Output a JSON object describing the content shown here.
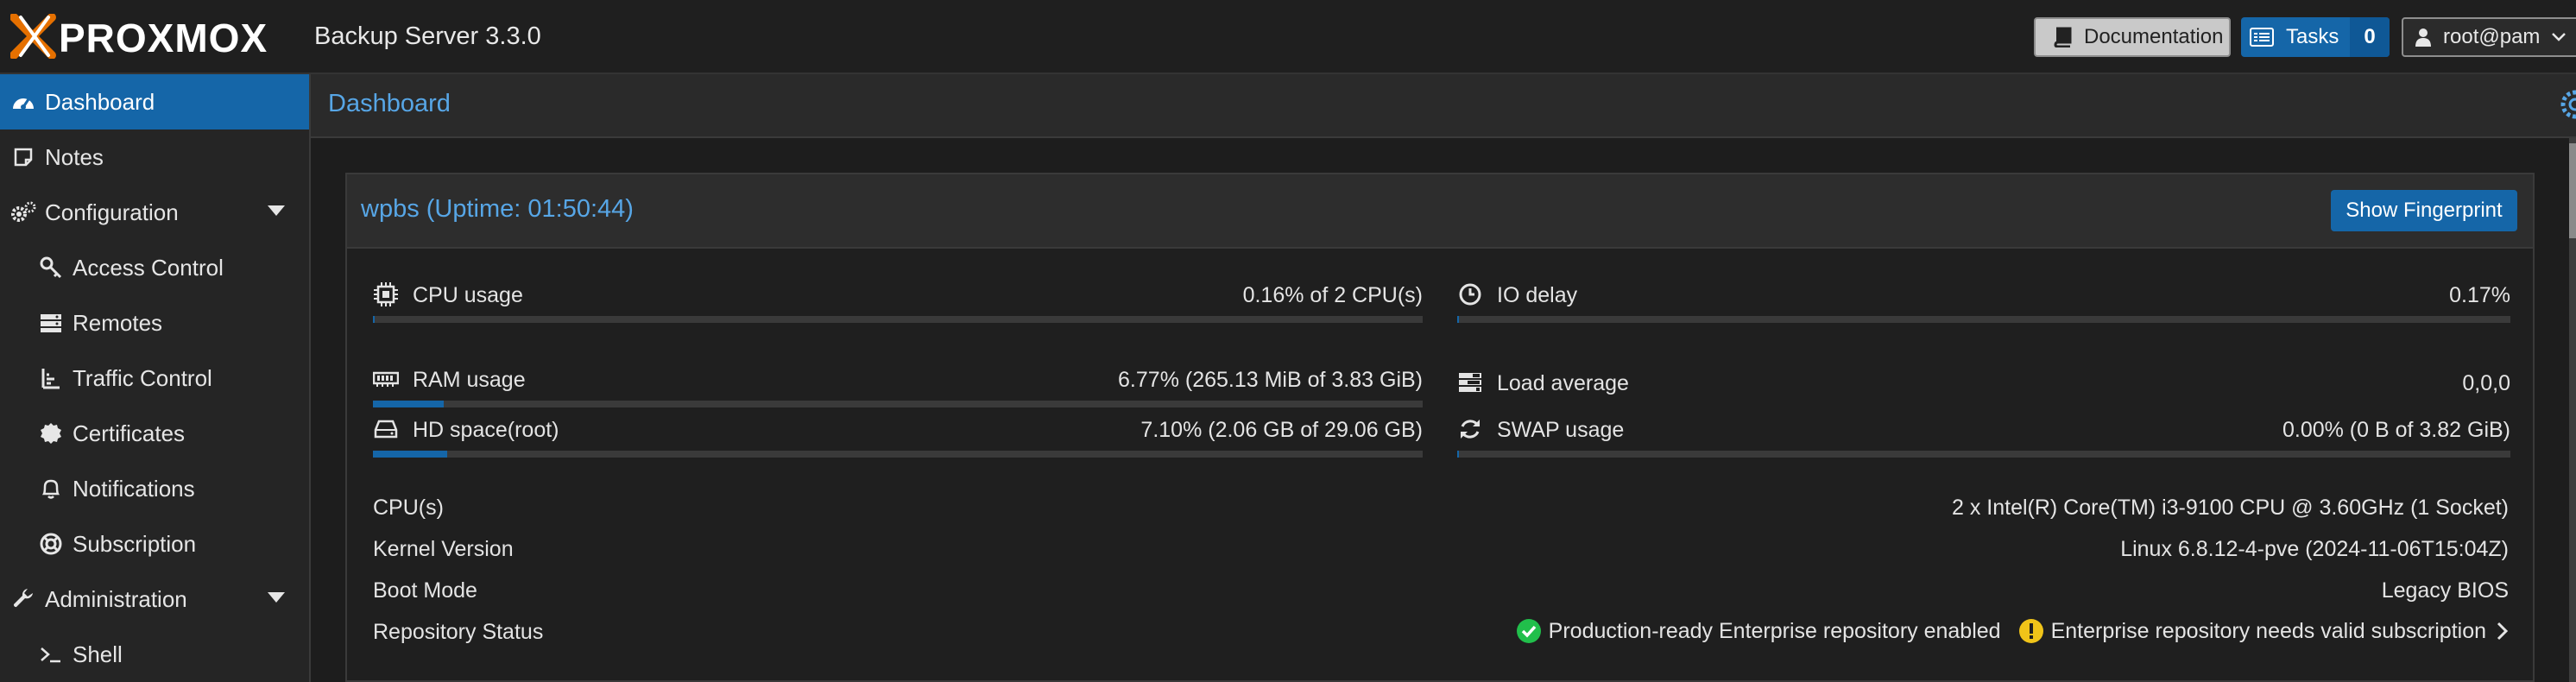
{
  "header": {
    "logo_text": "PROXMOX",
    "product_name": "Backup Server 3.3.0",
    "doc_label": "Documentation",
    "tasks_label": "Tasks",
    "tasks_count": "0",
    "user_label": "root@pam"
  },
  "sidebar": {
    "items": [
      {
        "label": "Dashboard",
        "icon": "dashboard-icon"
      },
      {
        "label": "Notes",
        "icon": "note-icon"
      },
      {
        "label": "Configuration",
        "icon": "cogs-icon"
      },
      {
        "label": "Access Control",
        "icon": "key-icon"
      },
      {
        "label": "Remotes",
        "icon": "server-icon"
      },
      {
        "label": "Traffic Control",
        "icon": "traffic-icon"
      },
      {
        "label": "Certificates",
        "icon": "certificate-icon"
      },
      {
        "label": "Notifications",
        "icon": "bell-icon"
      },
      {
        "label": "Subscription",
        "icon": "lifebuoy-icon"
      },
      {
        "label": "Administration",
        "icon": "wrench-icon"
      },
      {
        "label": "Shell",
        "icon": "terminal-icon"
      }
    ]
  },
  "main": {
    "title": "Dashboard",
    "panel_title": "wpbs (Uptime: 01:50:44)",
    "fingerprint_label": "Show Fingerprint",
    "stats": {
      "cpu": {
        "label": "CPU usage",
        "value": "0.16% of 2 CPU(s)",
        "percent": 0.16
      },
      "io": {
        "label": "IO delay",
        "value": "0.17%",
        "percent": 0.17
      },
      "ram": {
        "label": "RAM usage",
        "value": "6.77% (265.13 MiB of 3.83 GiB)",
        "percent": 6.77
      },
      "load": {
        "label": "Load average",
        "value": "0,0,0"
      },
      "hd": {
        "label": "HD space(root)",
        "value": "7.10% (2.06 GB of 29.06 GB)",
        "percent": 7.1
      },
      "swap": {
        "label": "SWAP usage",
        "value": "0.00% (0 B of 3.82 GiB)",
        "percent": 0
      }
    },
    "info": {
      "cpus_label": "CPU(s)",
      "cpus_value": "2 x Intel(R) Core(TM) i3-9100 CPU @ 3.60GHz (1 Socket)",
      "kernel_label": "Kernel Version",
      "kernel_value": "Linux 6.8.12-4-pve (2024-11-06T15:04Z)",
      "boot_label": "Boot Mode",
      "boot_value": "Legacy BIOS",
      "repo_label": "Repository Status",
      "repo_ok": "Production-ready Enterprise repository enabled",
      "repo_warn": "Enterprise repository needs valid subscription"
    }
  },
  "colors": {
    "accent": "#1566a8",
    "title_blue": "#57a6e6",
    "ok_green": "#21bf4b",
    "warn_yellow": "#f0c419",
    "logo_orange": "#e57000"
  }
}
